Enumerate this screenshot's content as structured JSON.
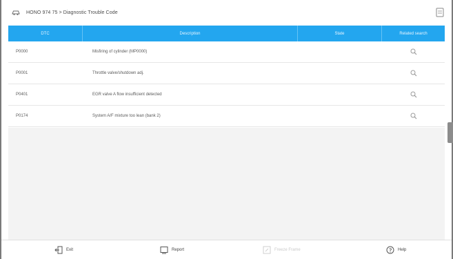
{
  "header": {
    "logo_icon": "car-logo-icon",
    "breadcrumb": "HONO 974 75 > Diagnostic Trouble Code",
    "doc_icon": "document-icon"
  },
  "table": {
    "columns": [
      "DTC",
      "Description",
      "State",
      "Related search"
    ],
    "rows": [
      {
        "code": "P0000",
        "description": "Misfiring of cylinder (MP0000)",
        "state": "",
        "search_icon": "search-icon"
      },
      {
        "code": "P0001",
        "description": "Throttle valve/shutdown adj.",
        "state": "",
        "search_icon": "search-icon"
      },
      {
        "code": "P0401",
        "description": "EGR valve A flow insufficient detected",
        "state": "",
        "search_icon": "search-icon"
      },
      {
        "code": "P0174",
        "description": "System A/F mixture too lean (bank 2)",
        "state": "",
        "search_icon": "search-icon"
      }
    ]
  },
  "footer": {
    "exit_label": "Exit",
    "report_label": "Report",
    "freeze_label": "Freeze Frame",
    "help_label": "Help"
  },
  "colors": {
    "header_accent": "#23a6ef",
    "empty_area": "#f3f3f3",
    "disabled_text": "#c9c9c9"
  }
}
